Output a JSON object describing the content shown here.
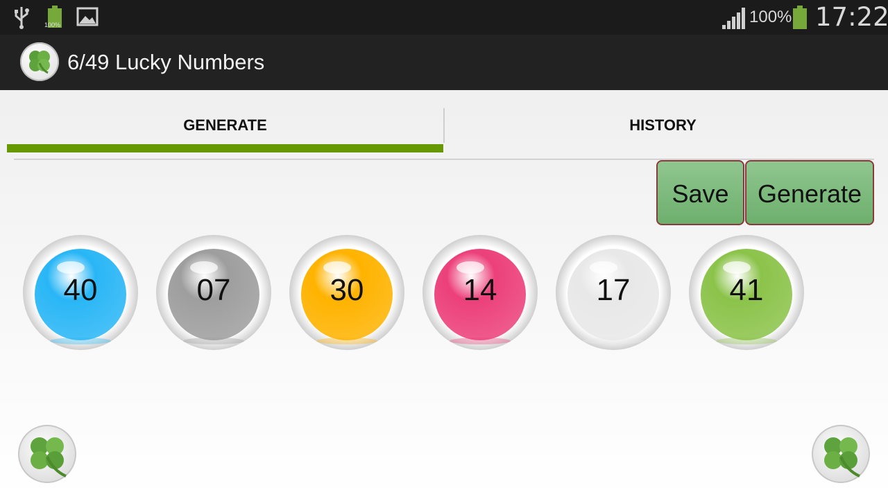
{
  "status_bar": {
    "battery_small_label": "100%",
    "battery_percent": "100%",
    "clock": "17:22"
  },
  "action_bar": {
    "title": "6/49 Lucky Numbers",
    "logo_icon": "clover-icon"
  },
  "tabs": [
    {
      "label": "GENERATE",
      "selected": true
    },
    {
      "label": "HISTORY",
      "selected": false
    }
  ],
  "buttons": {
    "save_label": "Save",
    "generate_label": "Generate"
  },
  "balls": [
    {
      "number": "40",
      "color": "#29b6f6"
    },
    {
      "number": "07",
      "color": "#9e9e9e"
    },
    {
      "number": "30",
      "color": "#ffb300"
    },
    {
      "number": "14",
      "color": "#ec407a"
    },
    {
      "number": "17",
      "color": "#e8e8e8"
    },
    {
      "number": "41",
      "color": "#8bc34a"
    }
  ],
  "colors": {
    "accent": "#669900",
    "button_green": "#7fbb7f",
    "button_border": "#8a3a3a"
  }
}
